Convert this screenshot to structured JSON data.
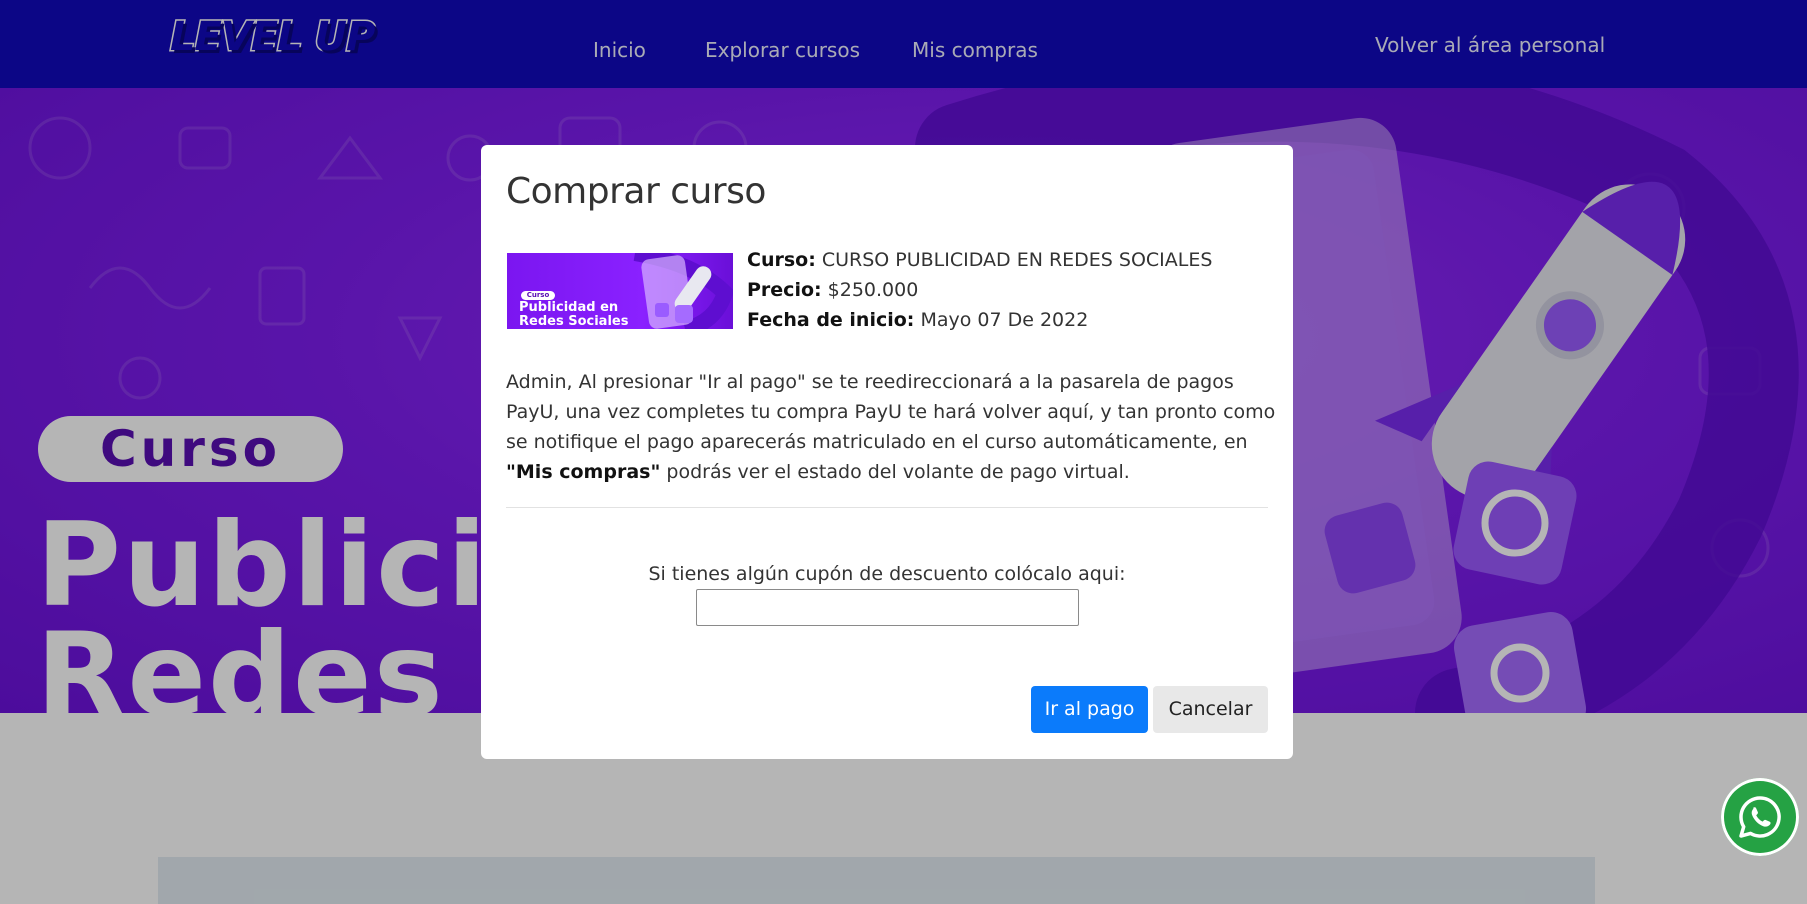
{
  "brand": {
    "logo_text": "LEVEL UP"
  },
  "nav": {
    "items": [
      {
        "label": "Inicio"
      },
      {
        "label": "Explorar cursos"
      },
      {
        "label": "Mis compras"
      }
    ],
    "personal_area": "Volver al área personal"
  },
  "hero": {
    "badge": "Curso",
    "line1": "Publicid",
    "line2": "Redes S"
  },
  "modal": {
    "title": "Comprar curso",
    "thumbnail": {
      "badge": "Curso",
      "line1": "Publicidad en",
      "line2": "Redes Sociales"
    },
    "course_label": "Curso:",
    "course_value": " CURSO PUBLICIDAD EN REDES SOCIALES",
    "price_label": "Precio:",
    "price_value": " $250.000",
    "start_label": "Fecha de inicio:",
    "start_value": " Mayo 07 De 2022",
    "message_part1": "Admin, Al presionar \"Ir al pago\" se te reedireccionará a la pasarela de pagos PayU, una vez completes tu compra PayU te hará volver aquí, y tan pronto como se notifique el pago aparecerás matriculado en el curso automáticamente, en ",
    "message_bold": "\"Mis compras\"",
    "message_part2": " podrás ver el estado del volante de pago virtual.",
    "coupon_label": "Si tienes algún cupón de descuento colócalo aqui:",
    "coupon_value": "",
    "pay_button": "Ir al pago",
    "cancel_button": "Cancelar"
  },
  "icons": {
    "whatsapp": "whatsapp-icon"
  },
  "colors": {
    "navbar": "#1109bd",
    "hero_purple": "#7f1ef0",
    "primary_button": "#0b7bfb",
    "whatsapp_green": "#25a244"
  }
}
